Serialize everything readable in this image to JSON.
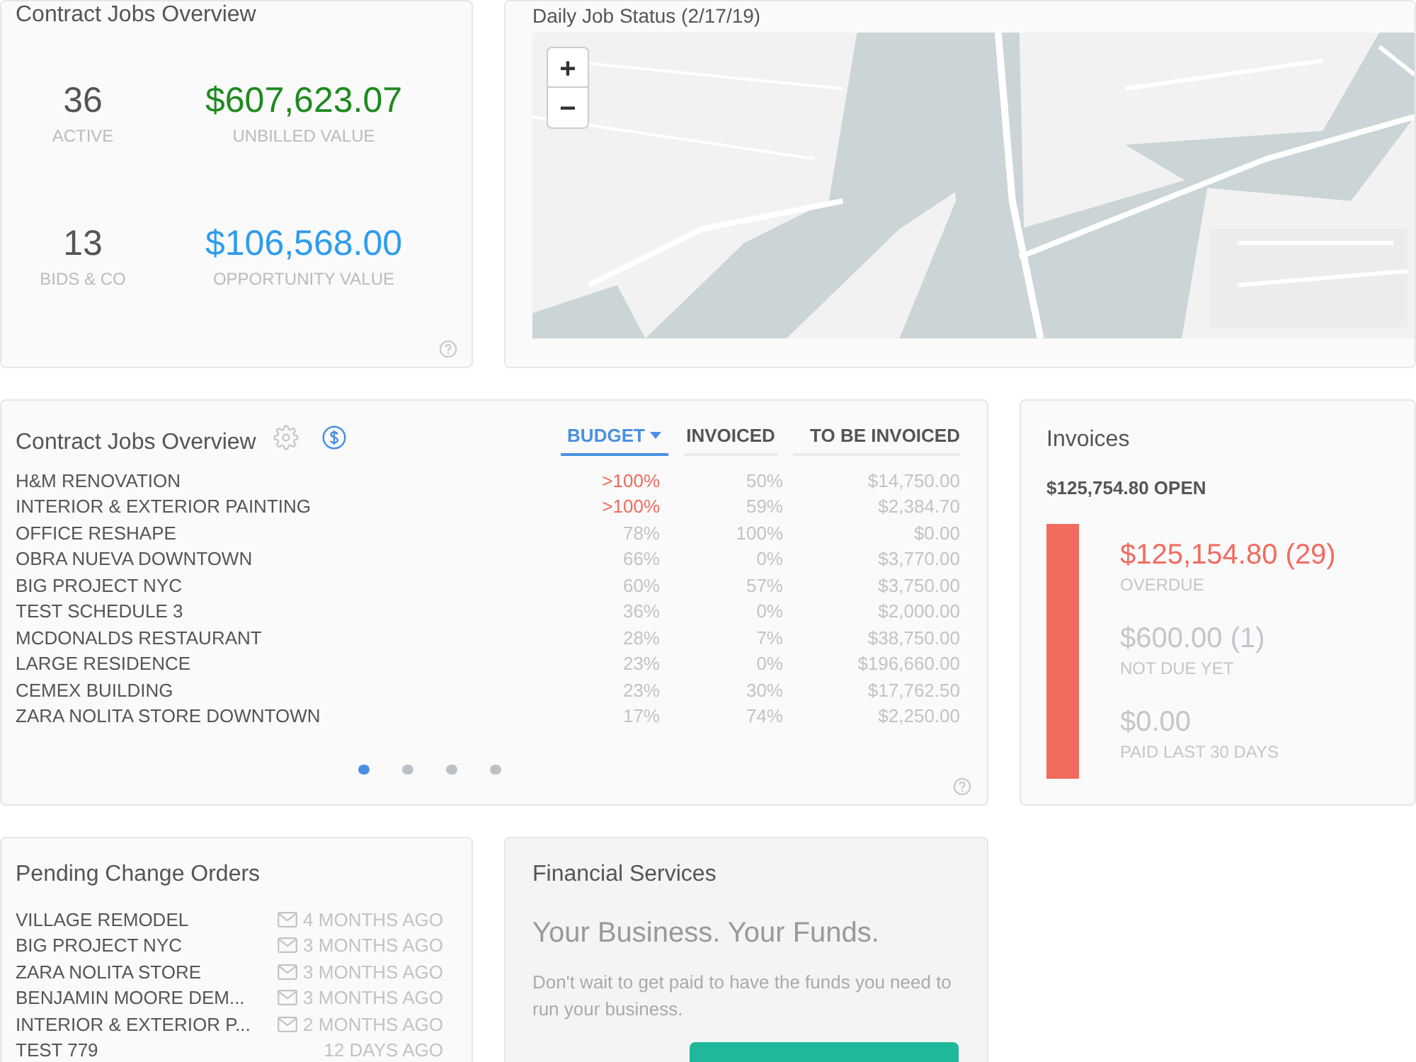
{
  "summary_card": {
    "title": "Contract Jobs Overview",
    "stats": [
      {
        "value": "36",
        "label": "ACTIVE",
        "amount": "$607,623.07",
        "amount_label": "UNBILLED VALUE",
        "color": "#1e8a1e"
      },
      {
        "value": "13",
        "label": "BIDS & CO",
        "amount": "$106,568.00",
        "amount_label": "OPPORTUNITY VALUE",
        "color": "#2d9cef"
      }
    ]
  },
  "map_card": {
    "title": "Daily Job Status (2/17/19)",
    "zoom_in": "+",
    "zoom_out": "−"
  },
  "jobs_card": {
    "title": "Contract Jobs Overview",
    "columns": [
      {
        "label": "BUDGET",
        "selected": true
      },
      {
        "label": "INVOICED",
        "selected": false
      },
      {
        "label": "TO BE INVOICED",
        "selected": false
      }
    ],
    "rows": [
      {
        "name": "H&M RENOVATION",
        "budget": ">100%",
        "over": true,
        "invoiced": "50%",
        "to_invoice": "$14,750.00"
      },
      {
        "name": "INTERIOR & EXTERIOR PAINTING",
        "budget": ">100%",
        "over": true,
        "invoiced": "59%",
        "to_invoice": "$2,384.70"
      },
      {
        "name": "OFFICE RESHAPE",
        "budget": "78%",
        "over": false,
        "invoiced": "100%",
        "to_invoice": "$0.00"
      },
      {
        "name": "OBRA NUEVA DOWNTOWN",
        "budget": "66%",
        "over": false,
        "invoiced": "0%",
        "to_invoice": "$3,770.00"
      },
      {
        "name": "BIG PROJECT NYC",
        "budget": "60%",
        "over": false,
        "invoiced": "57%",
        "to_invoice": "$3,750.00"
      },
      {
        "name": "TEST SCHEDULE 3",
        "budget": "36%",
        "over": false,
        "invoiced": "0%",
        "to_invoice": "$2,000.00"
      },
      {
        "name": "MCDONALDS RESTAURANT",
        "budget": "28%",
        "over": false,
        "invoiced": "7%",
        "to_invoice": "$38,750.00"
      },
      {
        "name": "LARGE RESIDENCE",
        "budget": "23%",
        "over": false,
        "invoiced": "0%",
        "to_invoice": "$196,660.00"
      },
      {
        "name": "CEMEX BUILDING",
        "budget": "23%",
        "over": false,
        "invoiced": "30%",
        "to_invoice": "$17,762.50"
      },
      {
        "name": "ZARA NOLITA STORE DOWNTOWN",
        "budget": "17%",
        "over": false,
        "invoiced": "74%",
        "to_invoice": "$2,250.00"
      }
    ],
    "pages": [
      {
        "selected": true
      },
      {
        "selected": false
      },
      {
        "selected": false
      },
      {
        "selected": false
      }
    ]
  },
  "invoices_card": {
    "title": "Invoices",
    "open_total": "$125,754.80 OPEN",
    "items": [
      {
        "amount": "$125,154.80 (29)",
        "label": "OVERDUE",
        "color": "#f26b5e"
      },
      {
        "amount": "$600.00 (1)",
        "label": "NOT DUE YET",
        "color": "#c3c6cb"
      },
      {
        "amount": "$0.00",
        "label": "PAID LAST 30 DAYS",
        "color": "#c3c6cb"
      }
    ]
  },
  "pending_card": {
    "title": "Pending Change Orders",
    "items": [
      {
        "name": "VILLAGE REMODEL",
        "emailed": true,
        "time": "4 MONTHS AGO"
      },
      {
        "name": "BIG PROJECT NYC",
        "emailed": true,
        "time": "3 MONTHS AGO"
      },
      {
        "name": "ZARA NOLITA STORE",
        "emailed": true,
        "time": "3 MONTHS AGO"
      },
      {
        "name": "BENJAMIN MOORE DEM...",
        "emailed": true,
        "time": "3 MONTHS AGO"
      },
      {
        "name": "INTERIOR & EXTERIOR P...",
        "emailed": true,
        "time": "2 MONTHS AGO"
      },
      {
        "name": "TEST 779",
        "emailed": false,
        "time": "12 DAYS AGO"
      }
    ]
  },
  "financial_card": {
    "title": "Financial Services",
    "headline": "Your Business. Your Funds.",
    "body": "Don't wait to get paid to have the funds you need to run your business."
  }
}
